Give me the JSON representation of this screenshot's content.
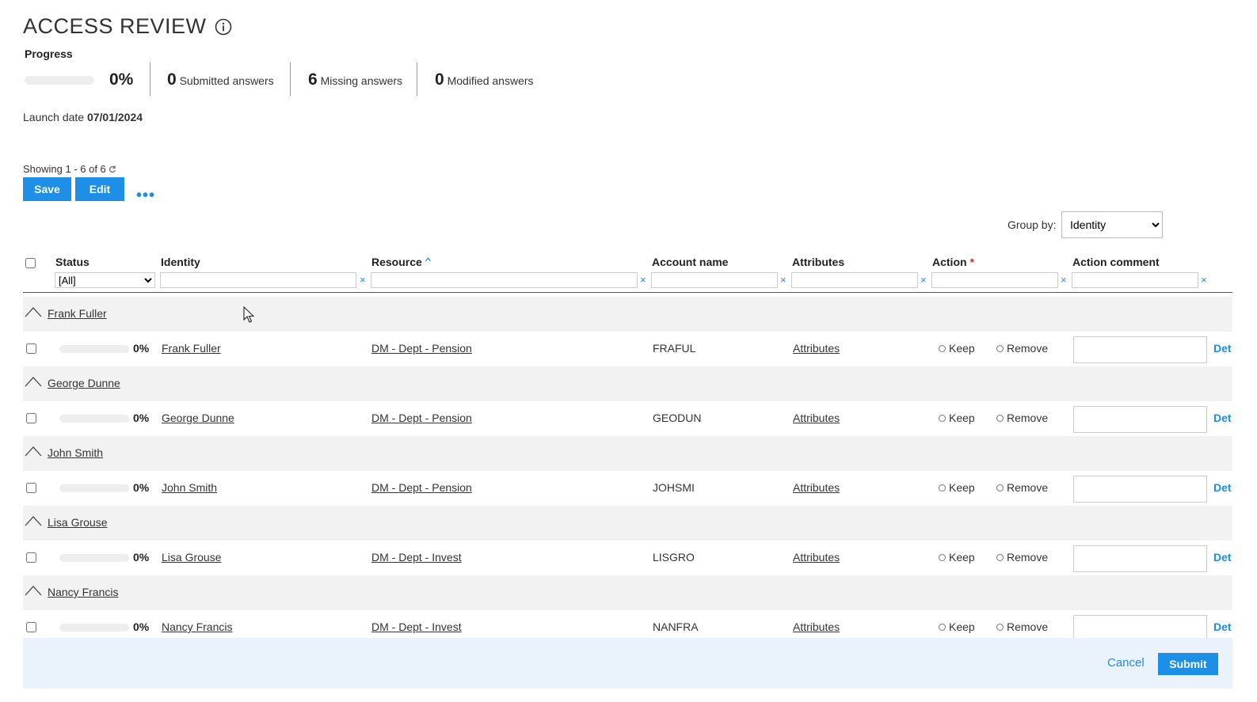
{
  "page": {
    "title": "ACCESS REVIEW",
    "progress_label": "Progress",
    "progress_percent_text": "0%",
    "progress_fraction": 0,
    "stats": [
      {
        "value": "0",
        "label": "Submitted answers"
      },
      {
        "value": "6",
        "label": "Missing answers"
      },
      {
        "value": "0",
        "label": "Modified answers"
      }
    ],
    "launch_label": "Launch date",
    "launch_date": "07/01/2024"
  },
  "toolbar": {
    "showing": "Showing 1 - 6 of 6",
    "save_label": "Save",
    "edit_label": "Edit",
    "more_label": "•••",
    "group_by_label": "Group by:",
    "group_by_value": "Identity"
  },
  "columns": {
    "status": "Status",
    "identity": "Identity",
    "resource": "Resource",
    "account_name": "Account name",
    "attributes": "Attributes",
    "action": "Action",
    "action_required": "*",
    "action_comment": "Action comment",
    "status_filter_value": "[All]",
    "clear": "×"
  },
  "groups": [
    {
      "group": "Frank Fuller",
      "pct": "0%",
      "identity": "Frank Fuller",
      "resource": "DM - Dept - Pension",
      "account": "FRAFUL",
      "attributes": "Attributes",
      "keep": "Keep",
      "remove": "Remove",
      "det": "Det"
    },
    {
      "group": "George Dunne",
      "pct": "0%",
      "identity": "George Dunne",
      "resource": "DM - Dept - Pension",
      "account": "GEODUN",
      "attributes": "Attributes",
      "keep": "Keep",
      "remove": "Remove",
      "det": "Det"
    },
    {
      "group": "John Smith",
      "pct": "0%",
      "identity": "John Smith",
      "resource": "DM - Dept - Pension",
      "account": "JOHSMI",
      "attributes": "Attributes",
      "keep": "Keep",
      "remove": "Remove",
      "det": "Det"
    },
    {
      "group": "Lisa Grouse",
      "pct": "0%",
      "identity": "Lisa Grouse",
      "resource": "DM - Dept - Invest",
      "account": "LISGRO",
      "attributes": "Attributes",
      "keep": "Keep",
      "remove": "Remove",
      "det": "Det"
    },
    {
      "group": "Nancy Francis",
      "pct": "0%",
      "identity": "Nancy Francis",
      "resource": "DM - Dept - Invest",
      "account": "NANFRA",
      "attributes": "Attributes",
      "keep": "Keep",
      "remove": "Remove",
      "det": "Det"
    }
  ],
  "footer": {
    "cancel_label": "Cancel",
    "submit_label": "Submit"
  },
  "colors": {
    "accent": "#1e8fe6",
    "group_row_bg": "#f2f2f2",
    "footer_bg": "#eaf3fb",
    "required": "#d32f2f"
  }
}
